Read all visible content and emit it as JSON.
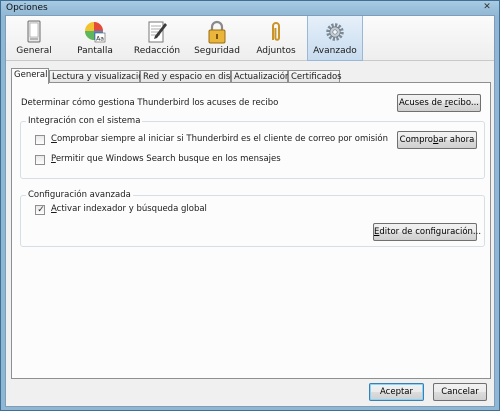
{
  "window": {
    "title": "Opciones",
    "close_glyph": "✕"
  },
  "toolbar": {
    "panes": [
      {
        "label": "General",
        "icon": "general-icon"
      },
      {
        "label": "Pantalla",
        "icon": "display-icon"
      },
      {
        "label": "Redacción",
        "icon": "composition-icon"
      },
      {
        "label": "Seguridad",
        "icon": "padlock-icon"
      },
      {
        "label": "Adjuntos",
        "icon": "paperclip-icon"
      },
      {
        "label": "Avanzado",
        "icon": "gear-icon",
        "selected": true
      }
    ]
  },
  "tabs": [
    {
      "label": "General",
      "selected": true
    },
    {
      "label": "Lectura y visualización"
    },
    {
      "label": "Red y espacio en disco"
    },
    {
      "label": "Actualización"
    },
    {
      "label": "Certificados"
    }
  ],
  "general": {
    "receipts_text": "Determinar cómo gestiona Thunderbird los acuses de recibo",
    "receipts_button": {
      "before": "Acuses de ",
      "access": "r",
      "after": "ecibo..."
    },
    "system_integration": {
      "caption": "Integración con el sistema",
      "default_client_check": {
        "before": "",
        "access": "C",
        "after": "omprobar siempre al iniciar si Thunderbird es el cliente de correo por omisión",
        "checked": false
      },
      "check_now_button": {
        "before": "Compro",
        "access": "b",
        "after": "ar ahora"
      },
      "windows_search_check": {
        "before": "",
        "access": "P",
        "after": "ermitir que Windows Search busque en los mensajes",
        "checked": false
      }
    },
    "advanced_config": {
      "caption": "Configuración avanzada",
      "indexer_check": {
        "before": "",
        "access": "A",
        "after": "ctivar indexador y búsqueda global",
        "checked": true,
        "check_glyph": "✓"
      },
      "config_editor_button": {
        "before": "",
        "access": "E",
        "after": "ditor de configuración..."
      }
    }
  },
  "footer": {
    "accept_label": "Aceptar",
    "cancel_label": "Cancelar"
  },
  "colors": {
    "selected_pane": "#c8dcef",
    "frame": "#9cc2dd",
    "default_button_border": "#3c7fb1"
  }
}
